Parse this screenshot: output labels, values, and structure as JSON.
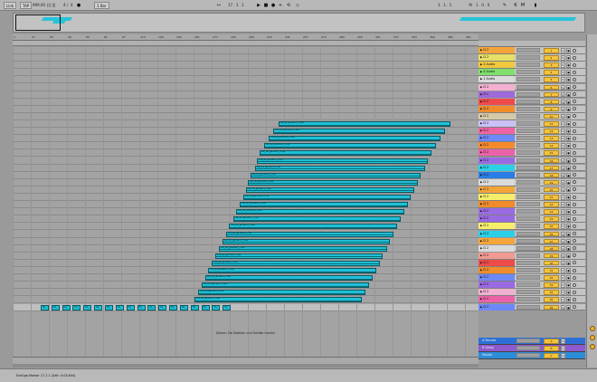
{
  "transport": {
    "link": "Link",
    "tap": "TAP",
    "tempo": "999.00",
    "nudge": "||| |||",
    "sig_num": "4",
    "sig_den": "4",
    "metro": "1 Bar",
    "position": "17 . 1 . 1",
    "loop_start": "3 . 1 . 1",
    "loop_len": "1 . 0 . 0"
  },
  "overview_clips": [
    {
      "pct": 5,
      "w": 5
    },
    {
      "pct": 7,
      "w": 2
    },
    {
      "pct": 78,
      "w": 20
    }
  ],
  "ruler": {
    "numbers": [
      "1",
      "17",
      "33",
      "49",
      "65",
      "81",
      "97",
      "113",
      "129",
      "145",
      "161",
      "177",
      "193",
      "209",
      "225",
      "241",
      "257",
      "273",
      "289",
      "305",
      "321",
      "337",
      "353",
      "369",
      "385",
      "401"
    ]
  },
  "clip_name": "Da_ist_jemand_Final",
  "staircase_lanes": [
    {
      "lane": 10,
      "start_pct": 57.0,
      "end_pct": 93.9
    },
    {
      "lane": 11,
      "start_pct": 56.0,
      "end_pct": 92.9
    },
    {
      "lane": 12,
      "start_pct": 55.0,
      "end_pct": 91.9
    },
    {
      "lane": 13,
      "start_pct": 54.0,
      "end_pct": 90.9
    },
    {
      "lane": 14,
      "start_pct": 53.0,
      "end_pct": 89.9
    },
    {
      "lane": 15,
      "start_pct": 52.5,
      "end_pct": 89.2
    },
    {
      "lane": 16,
      "start_pct": 52.0,
      "end_pct": 88.5
    },
    {
      "lane": 17,
      "start_pct": 51.0,
      "end_pct": 87.5
    },
    {
      "lane": 18,
      "start_pct": 50.5,
      "end_pct": 86.9
    },
    {
      "lane": 19,
      "start_pct": 50.0,
      "end_pct": 86.2
    },
    {
      "lane": 20,
      "start_pct": 49.5,
      "end_pct": 85.5
    },
    {
      "lane": 21,
      "start_pct": 48.8,
      "end_pct": 84.8
    },
    {
      "lane": 22,
      "start_pct": 48.0,
      "end_pct": 84.0
    },
    {
      "lane": 23,
      "start_pct": 47.3,
      "end_pct": 83.3
    },
    {
      "lane": 24,
      "start_pct": 46.5,
      "end_pct": 82.5
    },
    {
      "lane": 25,
      "start_pct": 45.8,
      "end_pct": 81.8
    },
    {
      "lane": 26,
      "start_pct": 45.0,
      "end_pct": 81.0
    },
    {
      "lane": 27,
      "start_pct": 44.3,
      "end_pct": 80.3
    },
    {
      "lane": 28,
      "start_pct": 43.5,
      "end_pct": 79.5
    },
    {
      "lane": 29,
      "start_pct": 42.8,
      "end_pct": 78.8
    },
    {
      "lane": 30,
      "start_pct": 42.0,
      "end_pct": 78.0
    },
    {
      "lane": 31,
      "start_pct": 41.3,
      "end_pct": 77.3
    },
    {
      "lane": 32,
      "start_pct": 40.5,
      "end_pct": 76.5
    },
    {
      "lane": 33,
      "start_pct": 39.8,
      "end_pct": 75.8
    },
    {
      "lane": 34,
      "start_pct": 39.0,
      "end_pct": 75.0
    }
  ],
  "small_clip_row": {
    "lane": 35,
    "count": 18,
    "start_pct": 6.0,
    "step_pct": 2.3
  },
  "small_clip_label": "Da_",
  "hint_text": "Ziehen Sie Dateien und Geräte hierhin",
  "tracks": [
    {
      "name": "D 2",
      "color": "#f3a53a",
      "num": "1"
    },
    {
      "name": "D 2",
      "color": "#e6e066",
      "num": "2"
    },
    {
      "name": "2 Audio",
      "color": "#f0c83b",
      "num": "3"
    },
    {
      "name": "4 Audio",
      "color": "#7fe06b",
      "num": "4"
    },
    {
      "name": "1 Audio",
      "color": "#dadada",
      "num": "5"
    },
    {
      "name": "D 2",
      "color": "#f3b0d0",
      "num": "6"
    },
    {
      "name": "D 2",
      "color": "#9e69d8",
      "num": "7"
    },
    {
      "name": "D 2",
      "color": "#ef4a4a",
      "num": "8"
    },
    {
      "name": "D 2",
      "color": "#f08c2a",
      "num": "9"
    },
    {
      "name": "D 2",
      "color": "#d6c9a8",
      "num": "10"
    },
    {
      "name": "D 2",
      "color": "#c9c1f7",
      "num": "11"
    },
    {
      "name": "D 2",
      "color": "#ee63a2",
      "num": "12"
    },
    {
      "name": "D 2",
      "color": "#6d88f7",
      "num": "13"
    },
    {
      "name": "D 2",
      "color": "#f48a2c",
      "num": "14"
    },
    {
      "name": "D 2",
      "color": "#ec62a8",
      "num": "15"
    },
    {
      "name": "D 2",
      "color": "#9a6ae3",
      "num": "16"
    },
    {
      "name": "D 2",
      "color": "#2ad0e6",
      "num": "17"
    },
    {
      "name": "D 2",
      "color": "#2a7de6",
      "num": "18"
    },
    {
      "name": "D 2",
      "color": "#dadada",
      "num": "19"
    },
    {
      "name": "D 2",
      "color": "#f3a53a",
      "num": "20"
    },
    {
      "name": "D 2",
      "color": "#f6ee6a",
      "num": "21"
    },
    {
      "name": "D 2",
      "color": "#f08a2b",
      "num": "22"
    },
    {
      "name": "D 2",
      "color": "#9a6ae3",
      "num": "23"
    },
    {
      "name": "D 2",
      "color": "#9a6ae3",
      "num": "24"
    },
    {
      "name": "D 2",
      "color": "#f6ee6a",
      "num": "25"
    },
    {
      "name": "D 2",
      "color": "#2ad0e6",
      "num": "26"
    },
    {
      "name": "D 2",
      "color": "#f4a53b",
      "num": "27"
    },
    {
      "name": "D 2",
      "color": "#dadada",
      "num": "28"
    },
    {
      "name": "D 2",
      "color": "#f19a92",
      "num": "29"
    },
    {
      "name": "D 2",
      "color": "#ef4a4a",
      "num": "30"
    },
    {
      "name": "D 2",
      "color": "#f08c2a",
      "num": "31"
    },
    {
      "name": "D 2",
      "color": "#6d88f7",
      "num": "32"
    },
    {
      "name": "D 2",
      "color": "#9a6ae3",
      "num": "33"
    },
    {
      "name": "D 2",
      "color": "#f1b0d0",
      "num": "34"
    },
    {
      "name": "D 2",
      "color": "#ec62a8",
      "num": "35"
    },
    {
      "name": "D 2",
      "color": "#6d88f7",
      "num": "36"
    }
  ],
  "returns": [
    {
      "name": "A Reverb",
      "color": "#2d6fd6",
      "num": "A"
    },
    {
      "name": "B Delay",
      "color": "#8f59d0",
      "num": "B"
    },
    {
      "name": "Master",
      "color": "#2c8dd8",
      "num": "0"
    }
  ],
  "status_text": "Einfüge-Marker 17.1.1 (Zeit: 0:03:844)",
  "colors": {
    "clip": "#1fc0d6",
    "accent": "#f4c23d"
  }
}
